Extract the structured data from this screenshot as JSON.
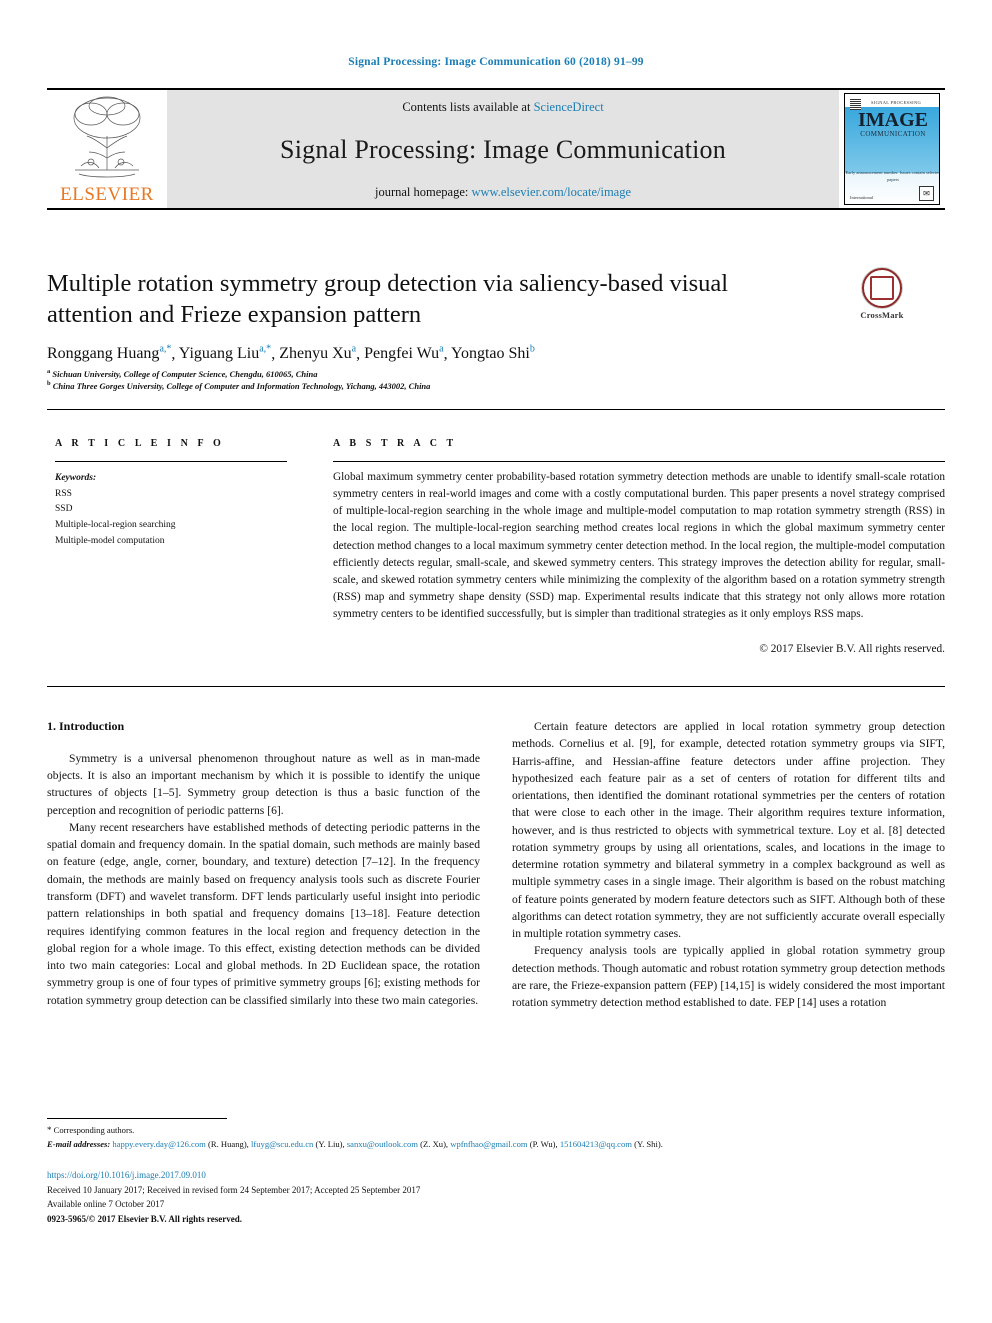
{
  "running_head": "Signal Processing: Image Communication 60 (2018) 91–99",
  "masthead": {
    "publisher": "ELSEVIER",
    "contents_prefix": "Contents lists available at ",
    "contents_link": "ScienceDirect",
    "journal_title": "Signal Processing: Image Communication",
    "homepage_prefix": "journal homepage: ",
    "homepage_link": "www.elsevier.com/locate/image",
    "cover": {
      "title": "IMAGE",
      "subtitle": "COMMUNICATION",
      "top_note": "SIGNAL PROCESSING",
      "mid_note": "Early announcement\nnumber. Issues contain selected papers",
      "bottom_left": "International",
      "badge": "✉"
    }
  },
  "article": {
    "title": "Multiple rotation symmetry group detection via saliency-based visual attention and Frieze expansion pattern",
    "authors": [
      {
        "name": "Ronggang Huang",
        "marks": "a,*"
      },
      {
        "name": "Yiguang Liu",
        "marks": "a,*"
      },
      {
        "name": "Zhenyu Xu",
        "marks": "a"
      },
      {
        "name": "Pengfei Wu",
        "marks": "a"
      },
      {
        "name": "Yongtao Shi",
        "marks": "b"
      }
    ],
    "affiliations": [
      {
        "mark": "a",
        "text": "Sichuan University, College of Computer Science, Chengdu, 610065, China"
      },
      {
        "mark": "b",
        "text": "China Three Gorges University, College of Computer and Information Technology, Yichang, 443002, China"
      }
    ],
    "crossmark_label": "CrossMark"
  },
  "info_section": {
    "heading": "A R T I C L E    I N F O",
    "keywords_title": "Keywords:",
    "keywords": [
      "RSS",
      "SSD",
      "Multiple-local-region searching",
      "Multiple-model computation"
    ]
  },
  "abstract_section": {
    "heading": "A B S T R A C T",
    "text": "Global maximum symmetry center probability-based rotation symmetry detection methods are unable to identify small-scale rotation symmetry centers in real-world images and come with a costly computational burden. This paper presents a novel strategy comprised of multiple-local-region searching in the whole image and multiple-model computation to map rotation symmetry strength (RSS) in the local region. The multiple-local-region searching method creates local regions in which the global maximum symmetry center detection method changes to a local maximum symmetry center detection method. In the local region, the multiple-model computation efficiently detects regular, small-scale, and skewed symmetry centers. This strategy improves the detection ability for regular, small-scale, and skewed rotation symmetry centers while minimizing the complexity of the algorithm based on a rotation symmetry strength (RSS) map and symmetry shape density (SSD) map. Experimental results indicate that this strategy not only allows more rotation symmetry centers to be identified successfully, but is simpler than traditional strategies as it only employs RSS maps.",
    "copyright": "© 2017 Elsevier B.V. All rights reserved."
  },
  "body": {
    "section_number_title": "1. Introduction",
    "left_paragraphs": [
      "Symmetry is a universal phenomenon throughout nature as well as in man-made objects. It is also an important mechanism by which it is possible to identify the unique structures of objects [1–5]. Symmetry group detection is thus a basic function of the perception and recognition of periodic patterns [6].",
      "Many recent researchers have established methods of detecting periodic patterns in the spatial domain and frequency domain. In the spatial domain, such methods are mainly based on feature (edge, angle, corner, boundary, and texture) detection [7–12]. In the frequency domain, the methods are mainly based on frequency analysis tools such as discrete Fourier transform (DFT) and wavelet transform. DFT lends particularly useful insight into periodic pattern relationships in both spatial and frequency domains [13–18]. Feature detection requires identifying common features in the local region and frequency detection in the global region for a whole image. To this effect, existing detection methods can be divided into two main categories: Local and global methods. In 2D Euclidean space, the rotation symmetry group is one of four types of primitive symmetry groups [6]; existing methods for rotation symmetry group detection can be classified similarly into these two main categories."
    ],
    "right_paragraphs": [
      "Certain feature detectors are applied in local rotation symmetry group detection methods. Cornelius et al. [9], for example, detected rotation symmetry groups via SIFT, Harris-affine, and Hessian-affine feature detectors under affine projection. They hypothesized each feature pair as a set of centers of rotation for different tilts and orientations, then identified the dominant rotational symmetries per the centers of rotation that were close to each other in the image. Their algorithm requires texture information, however, and is thus restricted to objects with symmetrical texture. Loy et al. [8] detected rotation symmetry groups by using all orientations, scales, and locations in the image to determine rotation symmetry and bilateral symmetry in a complex background as well as multiple symmetry cases in a single image. Their algorithm is based on the robust matching of feature points generated by modern feature detectors such as SIFT. Although both of these algorithms can detect rotation symmetry, they are not sufficiently accurate overall especially in multiple rotation symmetry cases.",
      "Frequency analysis tools are typically applied in global rotation symmetry group detection methods. Though automatic and robust rotation symmetry group detection methods are rare, the Frieze-expansion pattern (FEP) [14,15] is widely considered the most important rotation symmetry detection method established to date. FEP [14] uses a rotation"
    ]
  },
  "footnote": {
    "corresponding": "Corresponding authors.",
    "email_label": "E-mail addresses:",
    "emails": [
      {
        "address": "happy.every.day@126.com",
        "owner": "(R. Huang),"
      },
      {
        "address": "lfuyg@scu.edu.cn",
        "owner": "(Y. Liu),"
      },
      {
        "address": "sanxu@outlook.com",
        "owner": "(Z. Xu),"
      },
      {
        "address": "wpfnfhao@gmail.com",
        "owner": "(P. Wu),"
      },
      {
        "address": "151604213@qq.com",
        "owner": "(Y. Shi)."
      }
    ]
  },
  "footer": {
    "doi": "https://doi.org/10.1016/j.image.2017.09.010",
    "history": "Received 10 January 2017; Received in revised form 24 September 2017; Accepted 25 September 2017",
    "available": "Available online 7 October 2017",
    "issn_line": "0923-5965/© 2017 Elsevier B.V. All rights reserved."
  },
  "colors": {
    "link": "#1b7eb5",
    "citation": "#0f7fa8",
    "band": "#e3e3e3",
    "elsevier_orange": "#e87722"
  }
}
